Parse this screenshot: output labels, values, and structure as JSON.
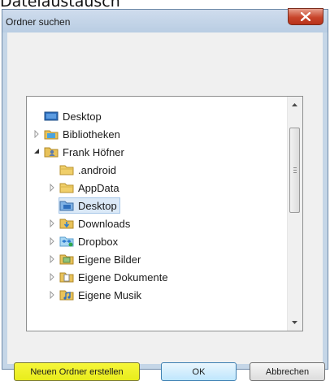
{
  "page": {
    "heading": "Dateiaustausch"
  },
  "dialog": {
    "title": "Ordner suchen"
  },
  "tree": {
    "items": [
      {
        "label": "Desktop",
        "icon": "desktop-icon",
        "expander": "none",
        "indent": 0
      },
      {
        "label": "Bibliotheken",
        "icon": "libraries-icon",
        "expander": "collapsed",
        "indent": 0
      },
      {
        "label": "Frank Höfner",
        "icon": "user-folder-icon",
        "expander": "expanded",
        "indent": 0
      },
      {
        "label": ".android",
        "icon": "folder-icon",
        "expander": "none",
        "indent": 1
      },
      {
        "label": "AppData",
        "icon": "folder-icon",
        "expander": "collapsed",
        "indent": 1
      },
      {
        "label": "Desktop",
        "icon": "desktop-folder-icon",
        "expander": "none",
        "indent": 1,
        "selected": true
      },
      {
        "label": "Downloads",
        "icon": "downloads-folder-icon",
        "expander": "collapsed",
        "indent": 1
      },
      {
        "label": "Dropbox",
        "icon": "dropbox-icon",
        "expander": "collapsed",
        "indent": 1
      },
      {
        "label": "Eigene Bilder",
        "icon": "pictures-folder-icon",
        "expander": "collapsed",
        "indent": 1
      },
      {
        "label": "Eigene Dokumente",
        "icon": "documents-folder-icon",
        "expander": "collapsed",
        "indent": 1
      },
      {
        "label": "Eigene Musik",
        "icon": "music-folder-icon",
        "expander": "collapsed",
        "indent": 1
      }
    ]
  },
  "buttons": {
    "new_folder": "Neuen Ordner erstellen",
    "ok": "OK",
    "cancel": "Abbrechen"
  },
  "colors": {
    "highlight": "#eef01e",
    "selection": "#dbe9f7",
    "close": "#c8452b"
  }
}
